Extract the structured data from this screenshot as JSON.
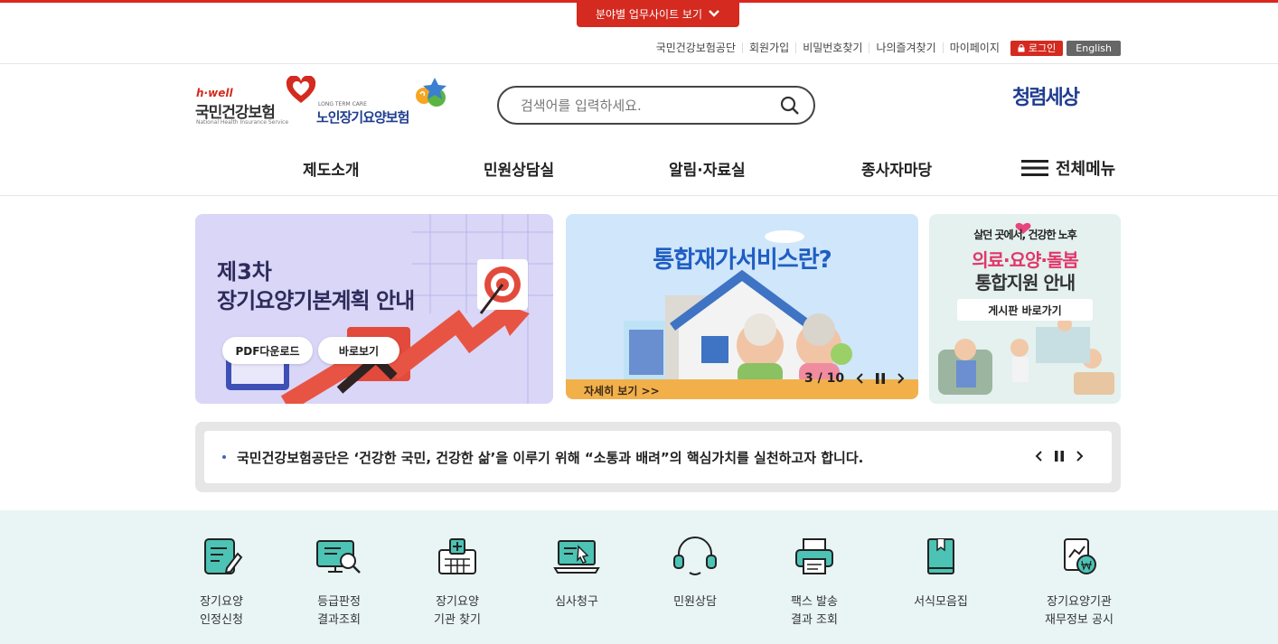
{
  "top_toggle": {
    "label": "분야별 업무사이트 보기"
  },
  "util_links": [
    "국민건강보험공단",
    "회원가입",
    "비밀번호찾기",
    "나의즐겨찾기",
    "마이페이지"
  ],
  "login_label": "로그인",
  "english_label": "English",
  "logos": {
    "nhis_tag": "h·well",
    "nhis_name": "국민건강보험",
    "nhis_en": "National Health Insurance Service",
    "ltc_en": "LONG TERM CARE",
    "ltc_name": "노인장기요양보험",
    "clean": "청렴세상"
  },
  "search": {
    "placeholder": "검색어를 입력하세요."
  },
  "gnb": [
    "제도소개",
    "민원상담실",
    "알림·자료실",
    "종사자마당"
  ],
  "all_menu": "전체메뉴",
  "banner1": {
    "line1": "제3차",
    "line2": "장기요양기본계획 안내",
    "btn_pdf": "PDF다운로드",
    "btn_view": "바로보기"
  },
  "banner2": {
    "title": "통합재가서비스란?",
    "more": "자세히 보기 >>",
    "counter": "3 / 10"
  },
  "banner3": {
    "line1": "살던 곳에서, 건강한 노후",
    "line2": "의료·요양·돌봄",
    "line3": "통합지원 안내",
    "btn": "게시판 바로가기"
  },
  "notice": {
    "text": "국민건강보험공단은 ‘건강한 국민, 건강한 삶’을 이루기 위해 “소통과 배려”의 핵심가치를 실천하고자 합니다."
  },
  "quick": [
    {
      "label": "장기요양\n인정신청",
      "icon": "document-pen-icon"
    },
    {
      "label": "등급판정\n결과조회",
      "icon": "monitor-search-icon"
    },
    {
      "label": "장기요양\n기관 찾기",
      "icon": "hospital-icon"
    },
    {
      "label": "심사청구",
      "icon": "laptop-cursor-icon"
    },
    {
      "label": "민원상담",
      "icon": "headset-icon"
    },
    {
      "label": "팩스 발송\n결과 조회",
      "icon": "fax-icon"
    },
    {
      "label": "서식모음집",
      "icon": "book-icon"
    },
    {
      "label": "장기요양기관\n재무정보 공시",
      "icon": "finance-document-icon"
    }
  ],
  "colors": {
    "brand_red": "#d42a1f",
    "icon_teal": "#4cc3b4",
    "navy": "#1f3d8f"
  }
}
